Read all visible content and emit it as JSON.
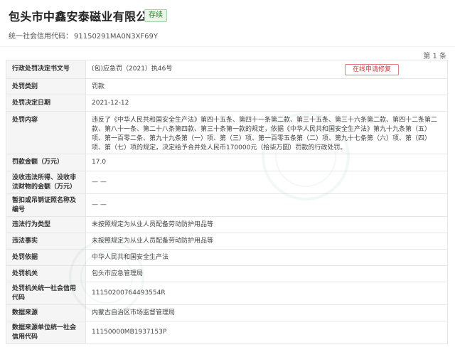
{
  "company": {
    "name": "包头市中鑫安泰磁业有限公司",
    "status": "存续",
    "credit_code_label": "统一社会信用代码：",
    "credit_code": "91150291MA0N3XF69Y"
  },
  "record_count": "第 1 条",
  "repair_button": "在线申请修复",
  "rows": [
    {
      "label": "行政处罚决定书文号",
      "value": "(包)应急罚（2021）执46号"
    },
    {
      "label": "处罚类别",
      "value": "罚款"
    },
    {
      "label": "处罚决定日期",
      "value": "2021-12-12"
    },
    {
      "label": "处罚内容",
      "value": "违反了《中华人民共和国安全生产法》第四十五条、第四十一条第二款、第三十五条、第三十六条第二款、第四十二条第二款、第八十一条、第二十八条第四款、第三十条第一款的规定，依据《中华人民共和国安全生产法》第九十九条第（五）项、第一百零二条、第九十九条第（一）项、第（三）项、第一百零五条第（二）项、第九十七条第（六）项、第（四）项、第（七）项的规定，决定给予合并处人民币170000元（拾柒万圆）罚款的行政处罚。"
    },
    {
      "label": "罚款金额（万元）",
      "value": "17.0"
    },
    {
      "label": "没收违法所得、没收非法财物的金额（万元）",
      "value": "— —"
    },
    {
      "label": "暂扣或吊销证照名称及编号",
      "value": "— —"
    },
    {
      "label": "违法行为类型",
      "value": "未按照规定为从业人员配备劳动防护用品等"
    },
    {
      "label": "违法事实",
      "value": "未按照规定为从业人员配备劳动防护用品等"
    },
    {
      "label": "处罚依据",
      "value": "中华人民共和国安全生产法"
    },
    {
      "label": "处罚机关",
      "value": "包头市应急管理局"
    },
    {
      "label": "处罚机关统一社会信用代码",
      "value": "11150200764493554R"
    },
    {
      "label": "数据来源",
      "value": "内蒙古自治区市场监督管理局"
    },
    {
      "label": "数据来源单位统一社会信用代码",
      "value": "11150000MB1937153P"
    }
  ]
}
